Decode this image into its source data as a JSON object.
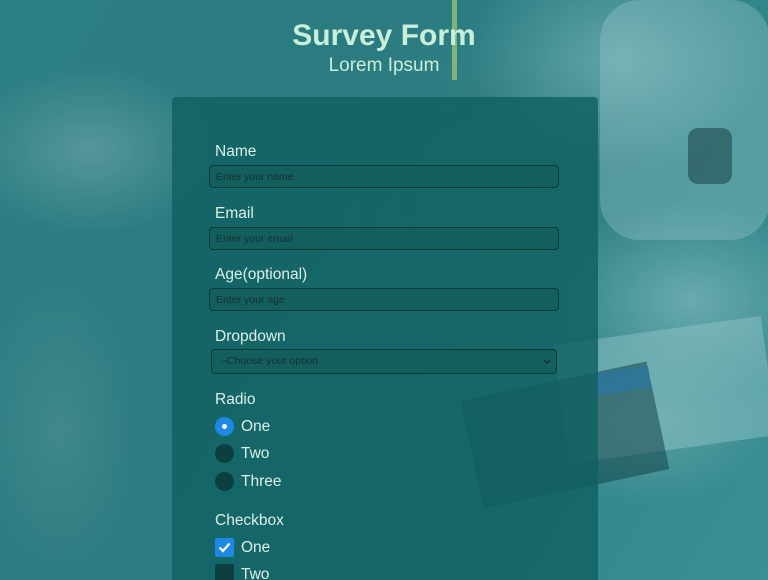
{
  "header": {
    "title": "Survey Form",
    "subtitle": "Lorem Ipsum"
  },
  "form": {
    "name": {
      "label": "Name",
      "placeholder": "Enter your name",
      "value": ""
    },
    "email": {
      "label": "Email",
      "placeholder": "Enter your email",
      "value": ""
    },
    "age": {
      "label": "Age(optional)",
      "placeholder": "Enter your age",
      "value": ""
    },
    "dropdown": {
      "label": "Dropdown",
      "selected": "--Choose your option"
    },
    "radio": {
      "label": "Radio",
      "options": [
        {
          "label": "One",
          "checked": true
        },
        {
          "label": "Two",
          "checked": false
        },
        {
          "label": "Three",
          "checked": false
        }
      ]
    },
    "checkbox": {
      "label": "Checkbox",
      "options": [
        {
          "label": "One",
          "checked": true
        },
        {
          "label": "Two",
          "checked": false
        }
      ]
    }
  },
  "colors": {
    "accent": "#1e88e5",
    "title": "#c8efd9",
    "card": "#106062"
  },
  "icons": {
    "dropdown": "chevron-down-icon",
    "checkbox_checked": "checkmark-icon"
  }
}
